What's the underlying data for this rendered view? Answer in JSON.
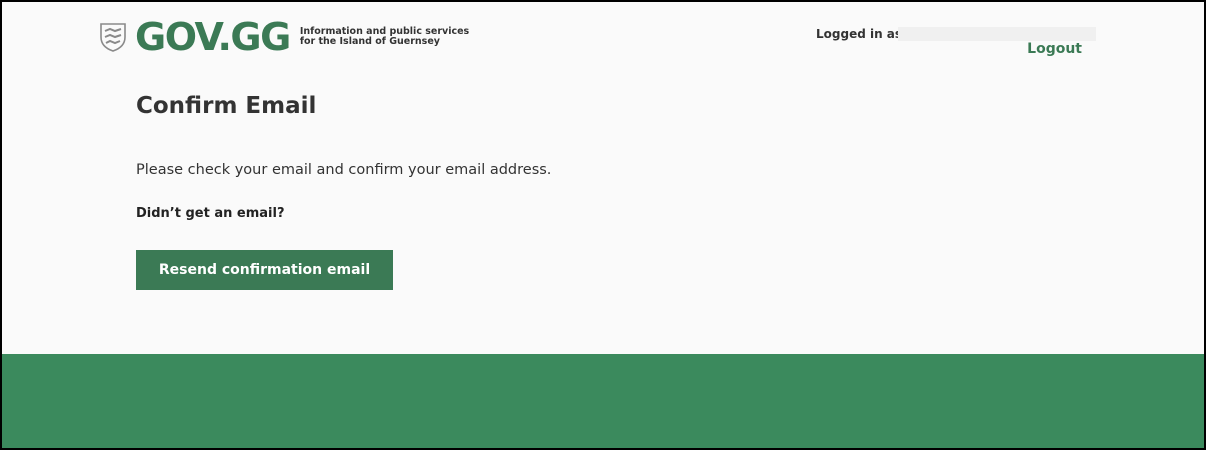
{
  "header": {
    "logo_text": "GOV.GG",
    "tagline_line1": "Information and public services",
    "tagline_line2": "for the Island of Guernsey",
    "crest_icon": "guernsey-crest-icon",
    "logged_in_label": "Logged in as",
    "logged_in_user": "",
    "logout_label": "Logout"
  },
  "main": {
    "title": "Confirm Email",
    "instruction": "Please check your email and confirm your email address.",
    "subheading": "Didn’t get an email?",
    "resend_button_label": "Resend confirmation email"
  },
  "colors": {
    "brand_green": "#3b7a55",
    "footer_green": "#3b8a5d",
    "page_background": "#fafafa",
    "text": "#333333"
  }
}
